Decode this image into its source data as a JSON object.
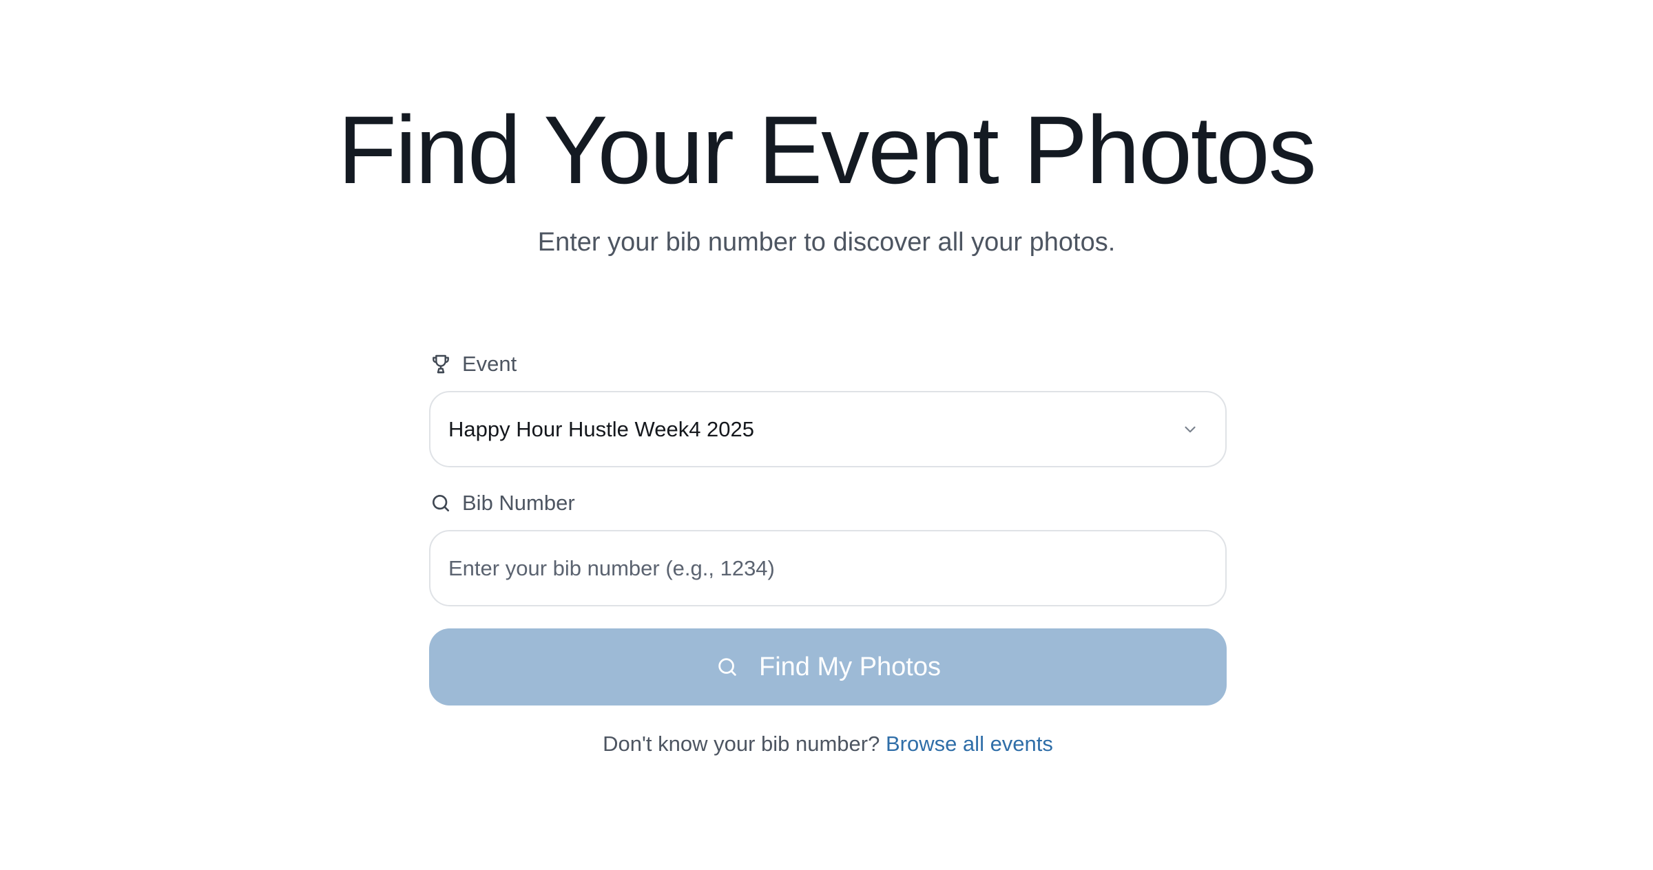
{
  "hero": {
    "title": "Find Your Event Photos",
    "subtitle": "Enter your bib number to discover all your photos."
  },
  "form": {
    "event": {
      "label": "Event",
      "icon": "trophy-icon",
      "selected_value": "Happy Hour Hustle Week4 2025",
      "dropdown_icon": "chevron-down-icon"
    },
    "bib": {
      "label": "Bib Number",
      "icon": "search-icon",
      "value": "",
      "placeholder": "Enter your bib number (e.g., 1234)"
    },
    "submit": {
      "label": "Find My Photos",
      "icon": "search-icon"
    }
  },
  "help": {
    "text": "Don't know your bib number?",
    "link_label": "Browse all events"
  },
  "colors": {
    "button_bg": "#9dbad6",
    "link": "#2f6ea8",
    "title": "#141a22",
    "muted_text": "#4d5561",
    "border": "#dfe2e6"
  }
}
